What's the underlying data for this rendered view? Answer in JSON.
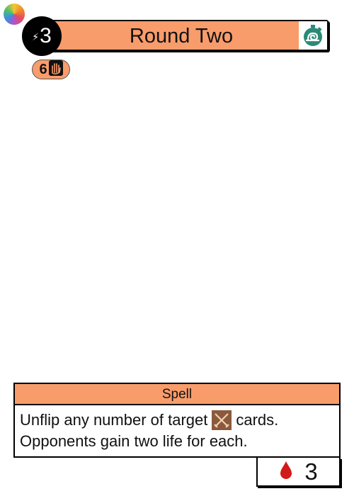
{
  "card": {
    "title": "Round Two",
    "cost": "3",
    "badge_value": "6",
    "type_line": "Spell",
    "rules_line1_before": "Unflip any number of target",
    "rules_line1_after": "cards.",
    "rules_line2": "Opponents gain two life for each.",
    "life_value": "3"
  },
  "icons": {
    "corner": "color-wheel-icon",
    "cost": "lightning-icon",
    "timer": "stopwatch-snail-icon",
    "badge": "hand-icon",
    "inline": "crossed-swords-icon",
    "life": "blood-drop-icon"
  },
  "colors": {
    "accent": "#f89c6c",
    "timer": "#2a8a76",
    "inline_icon": "#8b5a3c",
    "blood": "#d11a1a"
  }
}
